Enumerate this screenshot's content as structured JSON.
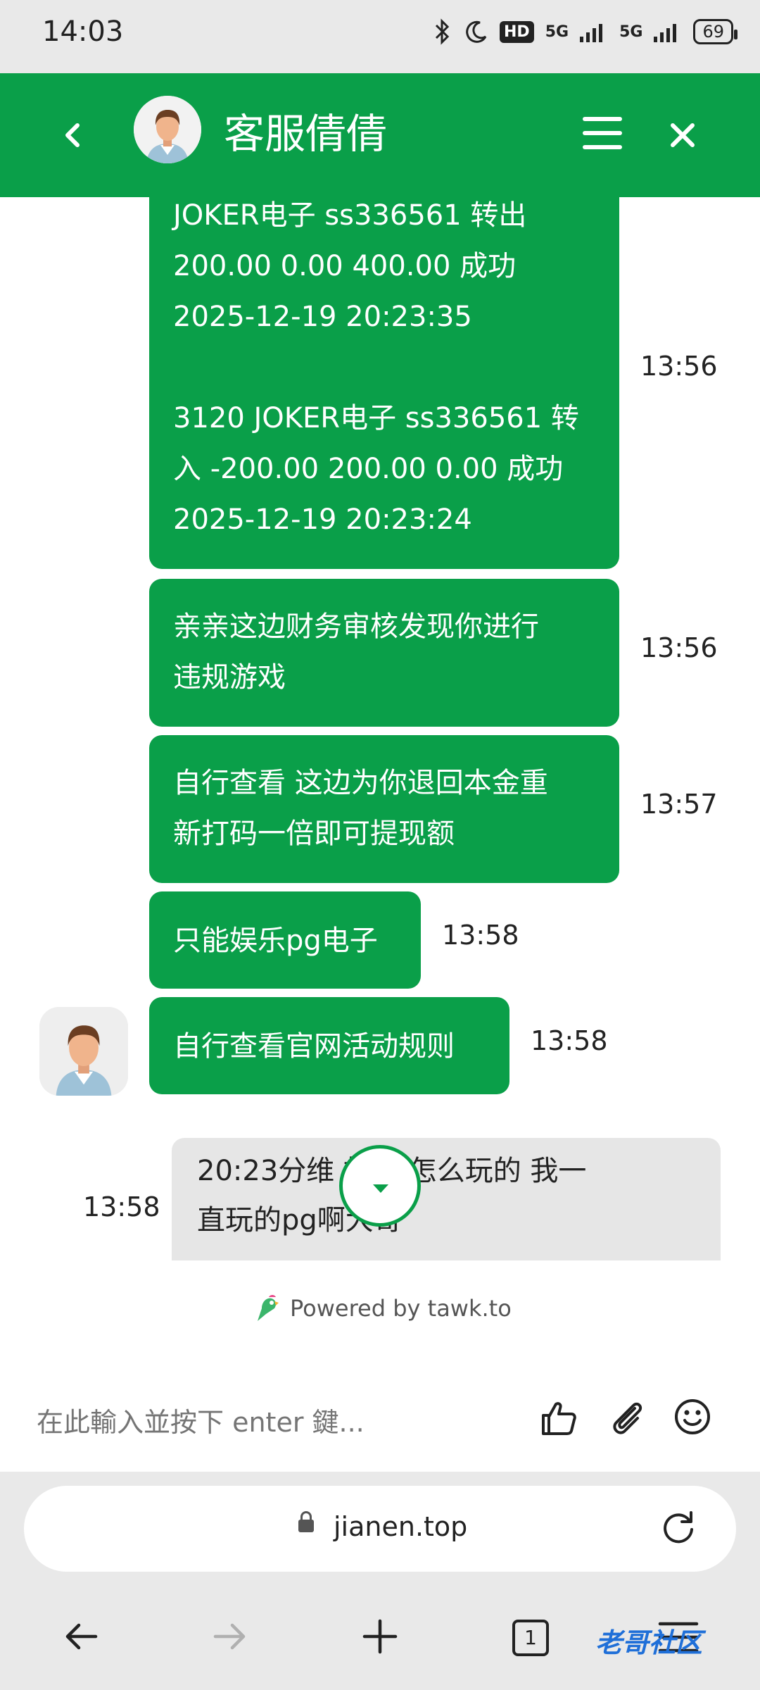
{
  "status_bar": {
    "time": "14:03",
    "network_5g_1": "5G",
    "network_5g_2": "5G",
    "hd_badge": "HD",
    "battery": "69",
    "icons": [
      "bluetooth-icon",
      "moon-icon",
      "signal-icon",
      "signal-icon",
      "battery-icon"
    ]
  },
  "header": {
    "title": "客服倩倩",
    "back_icon": "chevron-left-icon",
    "menu_icon": "menu-icon",
    "close_icon": "close-icon",
    "color": "#0a9f49"
  },
  "messages": [
    {
      "sender": "agent",
      "lines": [
        "JOKER电子 ss336561 转出",
        "200.00 0.00 400.00 成功",
        "2025-12-19 20:23:35",
        "",
        "3120 JOKER电子 ss336561 转",
        "入 -200.00 200.00 0.00 成功",
        "2025-12-19 20:23:24"
      ],
      "time": "13:56"
    },
    {
      "sender": "agent",
      "lines": [
        "亲亲这边财务审核发现你进行",
        "违规游戏"
      ],
      "time": "13:56"
    },
    {
      "sender": "agent",
      "lines": [
        "自行查看 这边为你退回本金重",
        "新打码一倍即可提现额"
      ],
      "time": "13:57"
    },
    {
      "sender": "agent",
      "lines": [
        "只能娱乐pg电子"
      ],
      "time": "13:58"
    },
    {
      "sender": "agent",
      "lines": [
        "自行查看官网活动规则"
      ],
      "time": "13:58"
    },
    {
      "sender": "visitor",
      "lines": [
        "20:23分维   故 我怎么玩的 我一",
        "直玩的pg啊大哥"
      ],
      "time": "13:58"
    }
  ],
  "powered_by": "Powered by tawk.to",
  "composer": {
    "placeholder": "在此輸入並按下 enter 鍵...",
    "icons": [
      "thumbs-up-icon",
      "paperclip-icon",
      "smiley-icon"
    ]
  },
  "browser": {
    "url": "jianen.top",
    "tab_count": "1",
    "watermark": "老哥社区"
  }
}
